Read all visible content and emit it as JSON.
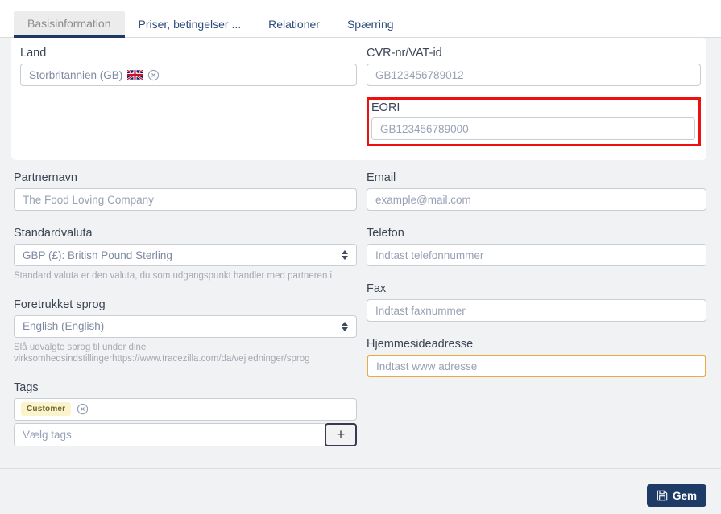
{
  "tabs": [
    {
      "label": "Basisinformation",
      "active": true
    },
    {
      "label": "Priser, betingelser ...",
      "active": false
    },
    {
      "label": "Relationer",
      "active": false
    },
    {
      "label": "Spærring",
      "active": false
    }
  ],
  "form": {
    "land": {
      "label": "Land",
      "value": "Storbritannien (GB)",
      "flag": "uk-flag"
    },
    "cvr": {
      "label": "CVR-nr/VAT-id",
      "placeholder": "GB123456789012"
    },
    "eori": {
      "label": "EORI",
      "placeholder": "GB123456789000"
    },
    "partnernavn": {
      "label": "Partnernavn",
      "placeholder": "The Food Loving Company"
    },
    "email": {
      "label": "Email",
      "placeholder": "example@mail.com"
    },
    "standardvaluta": {
      "label": "Standardvaluta",
      "value": "GBP (£): British Pound Sterling",
      "help": "Standard valuta er den valuta, du som udgangspunkt handler med partneren i"
    },
    "telefon": {
      "label": "Telefon",
      "placeholder": "Indtast telefonnummer"
    },
    "foretrukket_sprog": {
      "label": "Foretrukket sprog",
      "value": "English (English)",
      "help": "Slå udvalgte sprog til under dine virksomhedsindstillingerhttps://www.tracezilla.com/da/vejledninger/sprog"
    },
    "fax": {
      "label": "Fax",
      "placeholder": "Indtast faxnummer"
    },
    "hjemmeside": {
      "label": "Hjemmesideadresse",
      "placeholder": "Indtast www adresse"
    },
    "tags": {
      "label": "Tags",
      "tag": "Customer",
      "placeholder": "Vælg tags",
      "add_label": "+"
    }
  },
  "footer": {
    "save_label": "Gem"
  },
  "colors": {
    "page_bg": "#f1f2f4",
    "tab_text": "#2d4b7d",
    "active_tab_underline": "#1e3a64",
    "highlight_red": "#ee0f0f",
    "highlight_orange": "#ecaa44",
    "tag_yellow_bg": "#fbf3cb",
    "save_button_bg": "#1d3b66"
  }
}
